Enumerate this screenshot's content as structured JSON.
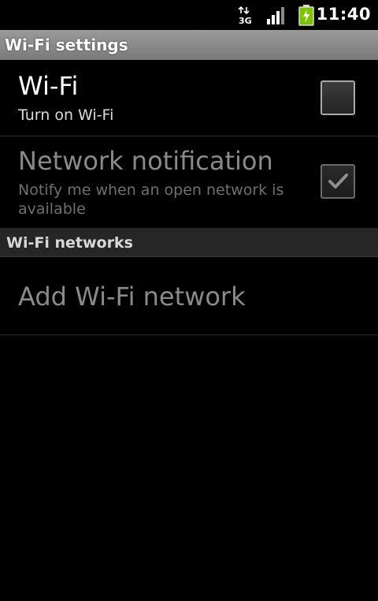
{
  "status_bar": {
    "network_type": "3G",
    "time": "11:40",
    "icons": [
      "3g-data-icon",
      "signal-strength-icon",
      "battery-charging-icon"
    ]
  },
  "title_bar": {
    "title": "Wi-Fi settings"
  },
  "prefs": {
    "wifi": {
      "title": "Wi-Fi",
      "summary": "Turn on Wi-Fi",
      "checked": false,
      "enabled": true
    },
    "network_notification": {
      "title": "Network notification",
      "summary": "Notify me when an open network is available",
      "checked": true,
      "enabled": false
    }
  },
  "wifi_networks": {
    "header": "Wi-Fi networks",
    "add_label": "Add Wi-Fi network"
  },
  "colors": {
    "background": "#000000",
    "title_bar": "#8a8a8a",
    "battery_green": "#7cc400",
    "disabled_text": "#8a8a8a"
  }
}
